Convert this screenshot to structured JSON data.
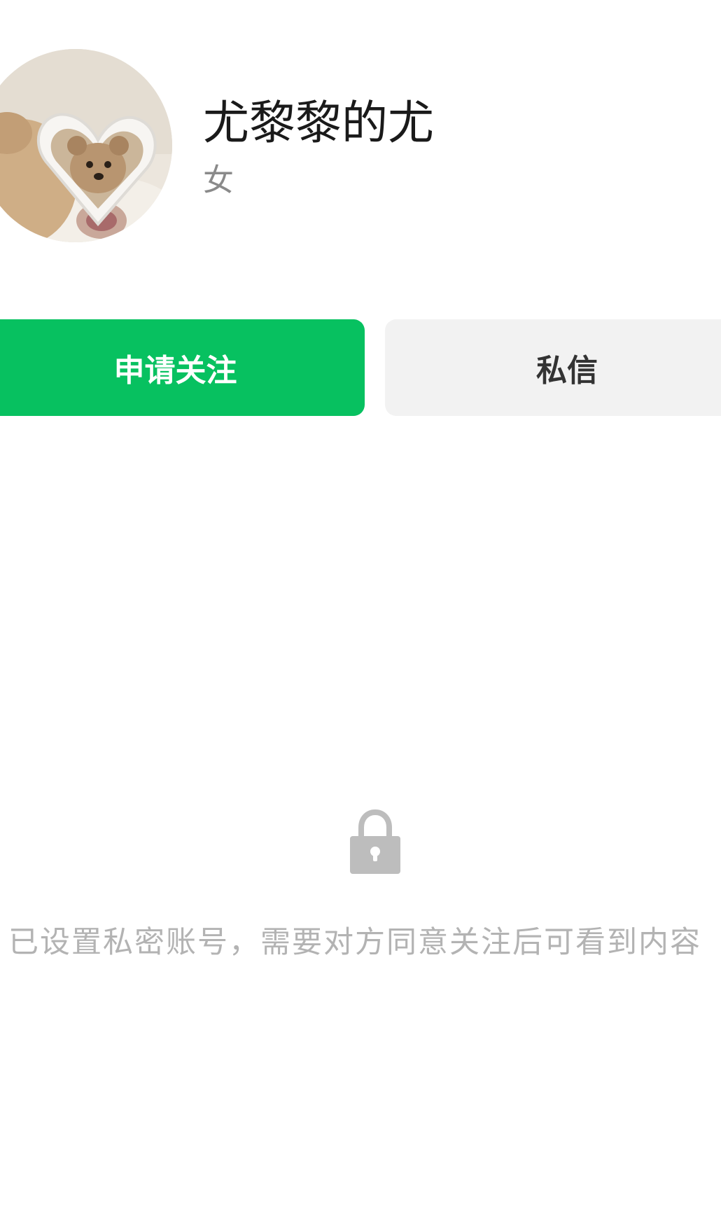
{
  "profile": {
    "name": "尤黎黎的尤",
    "gender": "女"
  },
  "actions": {
    "follow_label": "申请关注",
    "message_label": "私信"
  },
  "privacy": {
    "icon": "lock-icon",
    "message": "已设置私密账号，需要对方同意关注后可看到内容"
  },
  "colors": {
    "accent": "#07c160",
    "secondary_button_bg": "#f2f2f2",
    "hint_text": "#b3b3b3"
  }
}
